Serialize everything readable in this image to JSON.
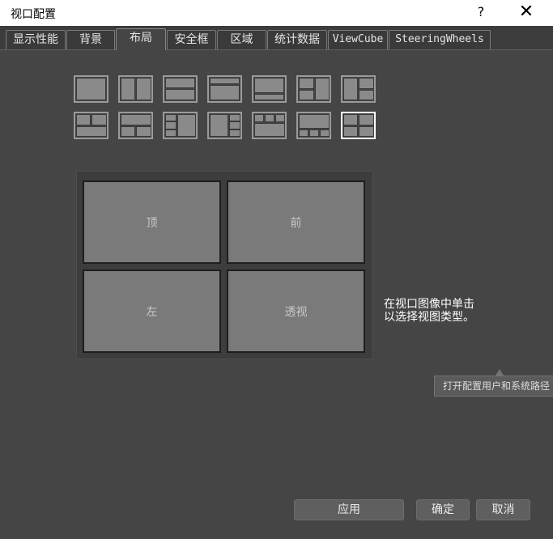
{
  "window": {
    "title": "视口配置",
    "help_label": "?",
    "close_label": "✕"
  },
  "tabs": [
    {
      "label": "显示性能",
      "active": false
    },
    {
      "label": "背景",
      "active": false
    },
    {
      "label": "布局",
      "active": true
    },
    {
      "label": "安全框",
      "active": false
    },
    {
      "label": "区域",
      "active": false
    },
    {
      "label": "统计数据",
      "active": false
    },
    {
      "label": "ViewCube",
      "active": false
    },
    {
      "label": "SteeringWheels",
      "active": false
    }
  ],
  "layout_options": {
    "selected_index": 13,
    "count": 14
  },
  "viewports": {
    "top_left": "顶",
    "top_right": "前",
    "bottom_left": "左",
    "bottom_right": "透视"
  },
  "hint_text": "在视口图像中单击以选择视图类型。",
  "tooltip_text": "打开配置用户和系统路径",
  "buttons": {
    "apply": "应用",
    "ok": "确定",
    "cancel": "取消"
  },
  "colors": {
    "background": "#454545",
    "selected_border": "#ffffff"
  }
}
